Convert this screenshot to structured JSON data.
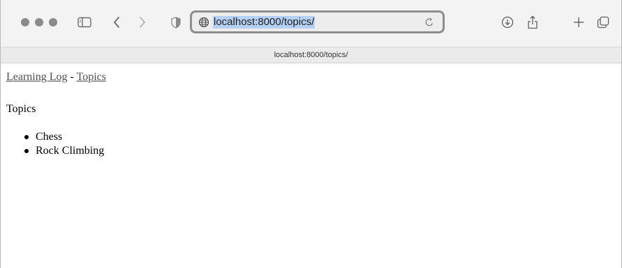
{
  "browser": {
    "url": "localhost:8000/topics/",
    "tab_title": "localhost:8000/topics/",
    "icons": {
      "sidebar": "sidebar-icon",
      "back": "chevron-left-icon",
      "forward": "chevron-right-icon",
      "privacy": "shield-icon",
      "site": "globe-icon",
      "reload": "reload-icon",
      "download": "download-icon",
      "share": "share-icon",
      "new_tab": "plus-icon",
      "tab_overview": "tabs-icon"
    }
  },
  "page": {
    "nav": {
      "home_link": "Learning Log",
      "separator": " - ",
      "topics_link": "Topics"
    },
    "heading": "Topics",
    "topics": [
      "Chess",
      "Rock Climbing"
    ]
  }
}
